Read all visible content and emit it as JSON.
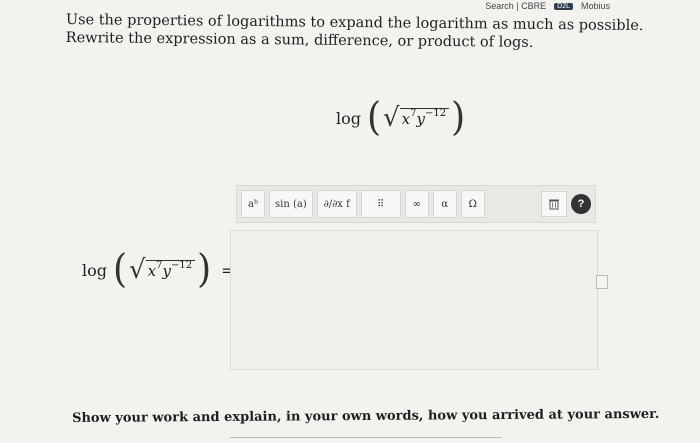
{
  "topbar": {
    "left_text": "Search | CBRE",
    "badge": "D2L",
    "right_text": "Mobius"
  },
  "prompt": {
    "text": "Use the properties of logarithms to expand the logarithm as much as possible. Rewrite the expression as a sum, difference, or product of logs."
  },
  "expression": {
    "op": "log",
    "x_base": "x",
    "x_exp": "7",
    "y_base": "y",
    "y_exp": "−12"
  },
  "answer_row": {
    "equals": "="
  },
  "toolbar": {
    "buttons": [
      {
        "label": "aᵇ"
      },
      {
        "label": "sin (a)"
      },
      {
        "label": "∂/∂x f"
      },
      {
        "label": "⠿"
      },
      {
        "label": "∞"
      },
      {
        "label": "α"
      },
      {
        "label": "Ω"
      }
    ]
  },
  "work_prompt": {
    "text": "Show your work and explain, in your own words, how you arrived at your answer."
  },
  "colors": {
    "page_bg": "#f3f2ef",
    "help_icon": "#333333",
    "toolbar_bg": "#e9e8e4"
  }
}
